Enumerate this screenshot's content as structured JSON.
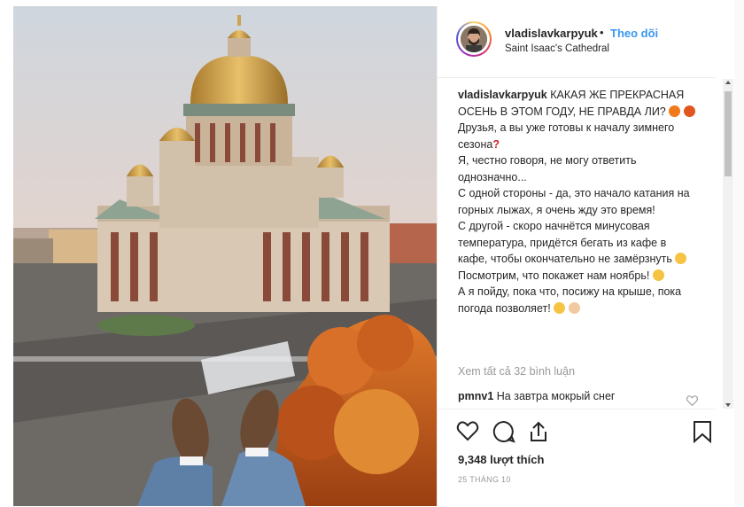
{
  "post": {
    "username": "vladislavkarpyuk",
    "dot": "•",
    "follow_label": "Theo dõi",
    "location": "Saint Isaac's Cathedral"
  },
  "caption": {
    "username": "vladislavkarpyuk",
    "line1": "КАКАЯ ЖЕ ПРЕКРАСНАЯ ОСЕНЬ В ЭТОМ ГОДУ, НЕ ПРАВДА ЛИ?",
    "line2": "Друзья, а вы уже готовы к началу зимнего сезона",
    "line3": "Я, честно говоря, не могу ответить однозначно...",
    "line4": "С одной стороны - да, это начало катания на горных лыжах, я очень жду это время!",
    "line5": "С другой - скоро начнётся минусовая температура, придётся бегать из кафе в кафе, чтобы окончательно не замёрзнуть",
    "line6": "Посмотрим, что покажет нам ноябрь!",
    "line7": "А я пойду, пока что, посижу на крыше, пока погода позволяет!"
  },
  "view_all_comments": "Xem tất cả 32 bình luận",
  "comment": {
    "username": "pmnv1",
    "text": "На завтра мокрый снег"
  },
  "likes": "9,348 lượt thích",
  "date": "25 THÁNG 10",
  "icons": {
    "like": "heart-icon",
    "comment": "comment-icon",
    "share": "share-icon",
    "save": "bookmark-icon",
    "comment_like": "heart-icon"
  },
  "colors": {
    "follow": "#3897f0",
    "muted": "#999999",
    "text": "#262626"
  }
}
